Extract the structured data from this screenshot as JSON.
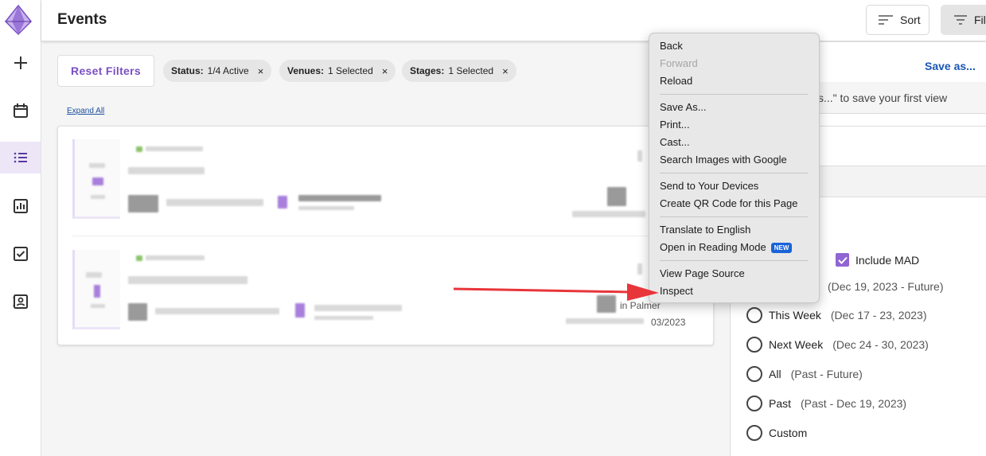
{
  "header": {
    "title": "Events",
    "sort_label": "Sort",
    "filter_label": "Filt"
  },
  "filters": {
    "reset_label": "Reset Filters",
    "chips": [
      {
        "key": "Status:",
        "value": "1/4 Active"
      },
      {
        "key": "Venues:",
        "value": "1 Selected"
      },
      {
        "key": "Stages:",
        "value": "1 Selected"
      }
    ],
    "expand_all": "Expand All"
  },
  "events": [
    {
      "right_partial_name": "",
      "right_partial_date": ""
    },
    {
      "right_partial_name": "in Palmer",
      "right_partial_date": "03/2023"
    }
  ],
  "panel": {
    "save_as": "Save as...",
    "hint": "s...\" to save your first view",
    "include_mad": "Include MAD",
    "top_range": "(Dec 19, 2023 - Future)",
    "options": [
      {
        "label": "This Week",
        "range": "(Dec 17 - 23, 2023)"
      },
      {
        "label": "Next Week",
        "range": "(Dec 24 - 30, 2023)"
      },
      {
        "label": "All",
        "range": "(Past - Future)"
      },
      {
        "label": "Past",
        "range": "(Past - Dec 19, 2023)"
      },
      {
        "label": "Custom",
        "range": ""
      }
    ]
  },
  "context_menu": {
    "items": [
      "Back",
      "Forward",
      "Reload",
      "Save As...",
      "Print...",
      "Cast...",
      "Search Images with Google",
      "Send to Your Devices",
      "Create QR Code for this Page",
      "Translate to English",
      "Open in Reading Mode",
      "View Page Source",
      "Inspect"
    ],
    "new_badge": "NEW"
  },
  "colors": {
    "accent": "#7a4fc3",
    "link": "#1a56b5",
    "annotation_arrow": "#e8353a"
  }
}
